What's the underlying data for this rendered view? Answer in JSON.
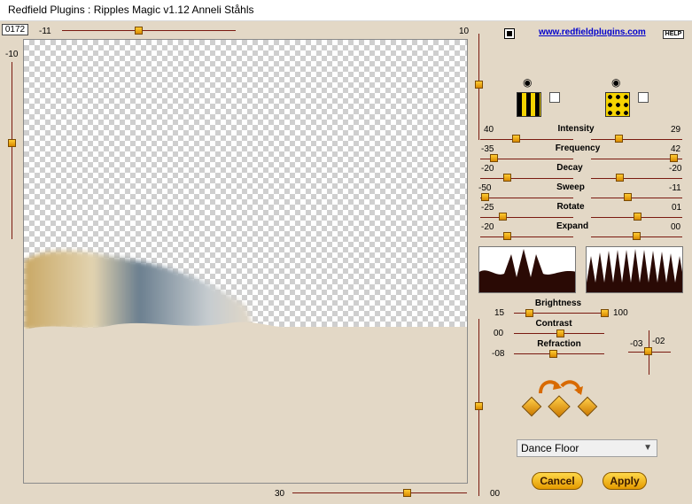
{
  "window": {
    "title": "Redfield Plugins : Ripples Magic v1.12   Anneli Ståhls"
  },
  "top": {
    "seed": "0172",
    "h_min": "-11",
    "h_max": "10",
    "v_top": "-10",
    "website": "www.redfieldplugins.com",
    "help": "HELP"
  },
  "params": {
    "intensity": {
      "label": "Intensity",
      "left": "40",
      "right": "29"
    },
    "frequency": {
      "label": "Frequency",
      "left": "-35",
      "right": "42"
    },
    "decay": {
      "label": "Decay",
      "left": "-20",
      "right": "-20"
    },
    "sweep": {
      "label": "Sweep",
      "left": "-50",
      "right": "-11"
    },
    "rotate": {
      "label": "Rotate",
      "left": "-25",
      "right": "01"
    },
    "expand": {
      "label": "Expand",
      "left": "-20",
      "right": "00"
    }
  },
  "light": {
    "brightness": {
      "label": "Brightness",
      "left": "15",
      "right": "100"
    },
    "contrast": {
      "label": "Contrast",
      "left": "00"
    },
    "refraction": {
      "label": "Refraction",
      "left": "-08"
    },
    "xy_left": "-03",
    "xy_right": "-02"
  },
  "bottom": {
    "left": "30",
    "right": "00"
  },
  "preset": {
    "selected": "Dance Floor"
  },
  "buttons": {
    "cancel": "Cancel",
    "apply": "Apply"
  },
  "colors": {
    "accent": "#ffcc33",
    "track": "#7a1a10",
    "bg": "#e3d8c6",
    "link": "#0000cc"
  }
}
